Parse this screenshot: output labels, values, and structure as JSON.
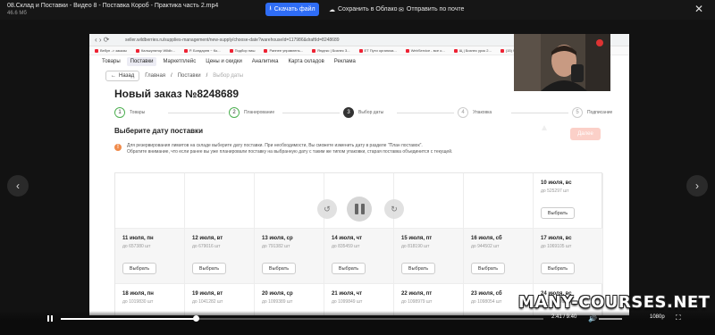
{
  "topbar": {
    "file_title": "08.Склад и Поставки - Видео 8 - Поставка Короб - Практика часть 2.mp4",
    "file_size": "46.6 Мб",
    "download_label": "Скачать файл",
    "save_cloud_label": "Сохранить в Облако",
    "send_mail_label": "Отправить по почте",
    "close_icon": "close-icon"
  },
  "browser": {
    "url": "seller.wildberries.ru/supplies-management/new-supply/choose-date?warehouseId=117986&draftId=8248689",
    "bookmarks": [
      "Вебун -> заказы",
      "Калькулятор Wildb...",
      "Р. Бондарев ~ Ко...",
      "Подбор ниш",
      "Раннее управлень...",
      "Яндекс | Бизнес 3...",
      "ЕТ Пути организа...",
      "WebService - все о...",
      "Щ | Бизнес урок 2...",
      "(15) WebService - ..."
    ]
  },
  "wb_nav": {
    "tabs": [
      "Товары",
      "Поставки",
      "Маркетплейс",
      "Цены и скидки",
      "Аналитика",
      "Карта складов",
      "Реклама"
    ],
    "active_index": 1
  },
  "breadcrumb": {
    "back_label": "Назад",
    "items": [
      "Главная",
      "Поставки",
      "Выбор даты"
    ]
  },
  "order_title": "Новый заказ №8248689",
  "steps": [
    {
      "num": "1",
      "label": "Товары",
      "state": "done"
    },
    {
      "num": "2",
      "label": "Планирование",
      "state": "done"
    },
    {
      "num": "3",
      "label": "Выбор даты",
      "state": "current"
    },
    {
      "num": "4",
      "label": "Упаковка",
      "state": "todo"
    },
    {
      "num": "5",
      "label": "Подписание",
      "state": "todo"
    }
  ],
  "section_title": "Выберите дату поставки",
  "next_label": "Далее",
  "notice": {
    "line1": "Для резервирования лимитов на складе выберите дату поставки. При необходимости, Вы сможете изменить дату в разделе \"План поставок\".",
    "line2": "Обратите внимание, что если ранее вы уже планировали поставку на выбранную дату с таким же типом упаковки, старая поставка объединится с текущей."
  },
  "calendar": {
    "choose_label": "Выбрать",
    "row1": [
      {
        "date": "10 июля, вс",
        "limit": "до 525297 шт"
      }
    ],
    "row2": [
      {
        "date": "11 июля, пн",
        "limit": "до 657380 шт"
      },
      {
        "date": "12 июля, вт",
        "limit": "до 679016 шт"
      },
      {
        "date": "13 июля, ср",
        "limit": "до 791382 шт"
      },
      {
        "date": "14 июля, чт",
        "limit": "до 835459 шт"
      },
      {
        "date": "15 июля, пт",
        "limit": "до 818190 шт"
      },
      {
        "date": "16 июля, сб",
        "limit": "до 944502 шт"
      },
      {
        "date": "17 июля, вс",
        "limit": "до 1069105 шт"
      }
    ],
    "row3": [
      {
        "date": "18 июля, пн",
        "limit": "до 1019830 шт"
      },
      {
        "date": "19 июля, вт",
        "limit": "до 1041282 шт"
      },
      {
        "date": "20 июля, ср",
        "limit": "до 1099389 шт"
      },
      {
        "date": "21 июля, чт",
        "limit": "до 1099849 шт"
      },
      {
        "date": "22 июля, пт",
        "limit": "до 1098979 шт"
      },
      {
        "date": "23 июля, сб",
        "limit": "до 1098054 шт"
      },
      {
        "date": "24 июля, вс",
        "limit": "до 1099999 шт"
      }
    ]
  },
  "player": {
    "time": "2:41 / 9:40",
    "quality": "1080p",
    "progress": 0.28,
    "volume": 1.0
  },
  "watermark": "MANY-COURSES.NET",
  "colors": {
    "download_button": "#2f6df6",
    "next_disabled": "#fbd0c8",
    "warning": "#f08b4b",
    "step_done": "#4caf50"
  }
}
